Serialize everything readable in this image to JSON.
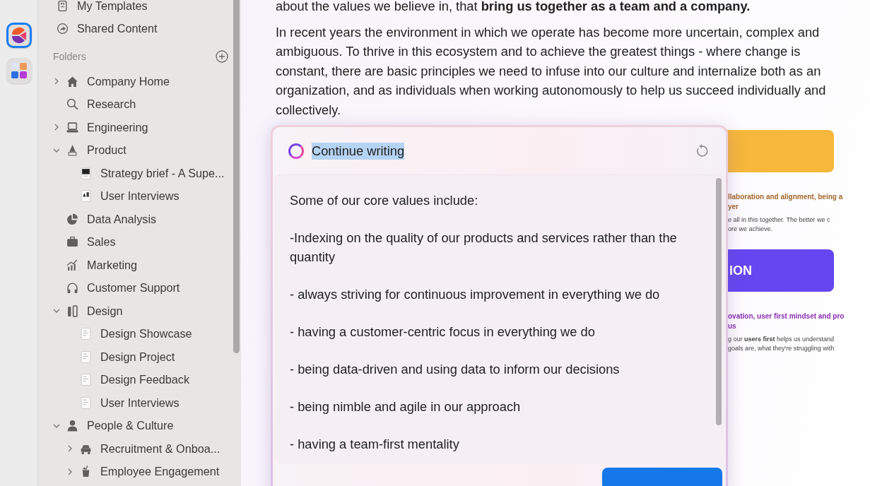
{
  "dock": [
    {
      "kind": "app",
      "selected": true
    },
    {
      "kind": "group",
      "selected": false
    }
  ],
  "nav": [
    {
      "label": "My Templates",
      "kind": "template"
    },
    {
      "label": "Shared Content",
      "kind": "share"
    }
  ],
  "folders_heading": "Folders",
  "folders": [
    {
      "label": "Company Home",
      "kind": "home",
      "expanded": false
    },
    {
      "label": "Research",
      "kind": "search"
    },
    {
      "label": "Engineering",
      "kind": "laptop",
      "expanded": false
    },
    {
      "label": "Product",
      "kind": "flask",
      "expanded": true,
      "children": [
        {
          "label": "Strategy brief - A Supe...",
          "kind": "thumb-dark"
        },
        {
          "label": "User Interviews",
          "kind": "thumb-photo"
        }
      ]
    },
    {
      "label": "Data Analysis",
      "kind": "pie"
    },
    {
      "label": "Sales",
      "kind": "briefcase"
    },
    {
      "label": "Marketing",
      "kind": "bars"
    },
    {
      "label": "Customer Support",
      "kind": "headphones"
    },
    {
      "label": "Design",
      "kind": "ruler",
      "expanded": true,
      "children": [
        {
          "label": "Design Showcase",
          "kind": "doc"
        },
        {
          "label": "Design Project",
          "kind": "doc"
        },
        {
          "label": "Design Feedback",
          "kind": "doc"
        },
        {
          "label": "User Interviews",
          "kind": "doc"
        }
      ]
    },
    {
      "label": "People & Culture",
      "kind": "person",
      "expanded": true,
      "children": [
        {
          "label": "Recruitment & Onboa...",
          "kind": "car",
          "expanded": false
        },
        {
          "label": "Employee Engagement",
          "kind": "cup",
          "expanded": false
        }
      ]
    }
  ],
  "paragraphs": [
    "about the values we believe in, that **bring us together as a team and a company.**",
    "In recent years the environment in which we operate has become more uncertain, complex and ambiguous. To thrive in this ecosystem and to achieve the greatest things - where change is constant, there are basic principles we need to infuse into our culture and internalize both as an organization, and as individuals when working autonomously to help us succeed individually and collectively."
  ],
  "cards": [
    {
      "color": "#f6b73c",
      "title_lines": [
        "llaboration and alignment, being a",
        "yer"
      ],
      "body_lines": [
        "e all in this together. The better we c",
        "ore we achieve."
      ]
    },
    {
      "color": "#6447f0",
      "heading": "ION",
      "title_lines": [
        "ovation, user first mindset and pro",
        "us"
      ],
      "body_lines": [
        "g our **users first** helps us understand",
        "goals are, what they're struggling with"
      ]
    }
  ],
  "assistant": {
    "prompt": "Continue writing",
    "prompt_selected": true,
    "lines": [
      "Some of our core values include:",
      "-Indexing on the quality of our products and services rather than the quantity",
      "- always striving for continuous improvement in everything we do",
      "- having a customer-centric focus in everything we do",
      "- being data-driven and using data to inform our decisions",
      "- being nimble and agile in our approach",
      "- having a team-first mentality"
    ]
  }
}
